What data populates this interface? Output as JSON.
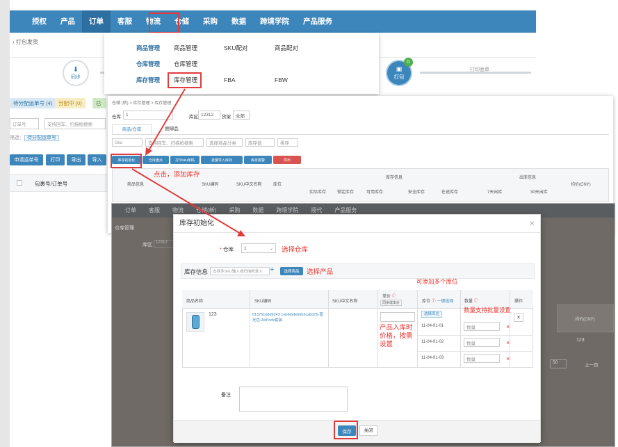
{
  "topnav": {
    "items": [
      "授权",
      "产品",
      "订单",
      "客服",
      "物流",
      "仓储",
      "采购",
      "数据",
      "跨境学院",
      "产品服务"
    ],
    "active": "仓储"
  },
  "breadcrumb": "打包发货",
  "mega_menu": {
    "rows": [
      {
        "head": "商品管理",
        "items": [
          "商品管理",
          "SKU配对",
          "商品配对"
        ]
      },
      {
        "head": "仓库管理",
        "items": [
          "仓库管理"
        ]
      },
      {
        "head": "库存管理",
        "items": [
          "库存管理",
          "FBA",
          "FBW"
        ]
      }
    ]
  },
  "steps": {
    "sync": "同步",
    "pack": "打包",
    "pack_badge": "0",
    "print": "打印面单"
  },
  "tags": {
    "distributed": "待分配运单号 (4)",
    "allocating": "分配中 (0)",
    "third": "已"
  },
  "left_filters": {
    "order_no": "订单号",
    "search_placeholder": "支持回车、扫描枪搜索",
    "chip": "待分配运单号"
  },
  "left_buttons": {
    "apply": "申请运单号",
    "print": "打印",
    "export": "导出",
    "import": "导入"
  },
  "left_table": {
    "col": "包裹号/订单号"
  },
  "inventory_panel": {
    "crumb": "仓储 (新) > 库存管理 > 库存管理",
    "warehouse_label": "仓库",
    "warehouse_value": "1",
    "area_label": "库区",
    "area_value": "12312",
    "filter_label": "货架",
    "filter_value": "全部",
    "tabs": [
      "商品/仓库",
      "捆绑品"
    ],
    "search_label": "Sku",
    "search_placeholder": "支持回车、扫描枪搜索",
    "category": "选择商品分类",
    "stock_status": "库存值",
    "sort": "排序",
    "buttons": [
      "库存初始化",
      "仓库盘点",
      "打印sku条码",
      "批量导入库存",
      "库存报警",
      "导出"
    ],
    "headers": [
      "商品信息",
      "SKU编码",
      "SKU中文名称",
      "库位",
      "实际库存",
      "锁定库存",
      "可用库存",
      "安全库存",
      "在途库存",
      "库存信息",
      "出库信息",
      "7天出库",
      "30天出库",
      "均价(CNY)"
    ]
  },
  "annotations": {
    "add_stock": "点击，添加库存",
    "select_warehouse": "选择仓库",
    "select_product": "选择产品",
    "multi_location": "可添加多个库位",
    "batch_qty": "数量支持批量设置",
    "price_note": "产品入库时价格，按需设置"
  },
  "modal": {
    "title": "库存初始化",
    "warehouse_label": "仓库",
    "warehouse_value": "1",
    "stock_info": "库存信息",
    "search_placeholder": "支持多SKU输入或扫描枪录入",
    "select_product_btn": "选择商品",
    "headers": [
      "商品名称",
      "SKU编码",
      "SKU中文名称",
      "单价",
      "库位",
      "数量",
      "操作"
    ],
    "price_sub": "同步成本价",
    "location_batch": "一键选择",
    "location_btn": "选择库位",
    "row": {
      "name": "123",
      "sku": "613751e8d9243 1eb6defeb0b3cabd7b-蓝光色-AirPods套装"
    },
    "locations": [
      "11-04-01-01",
      "11-04-01-02",
      "11-04-01-03"
    ],
    "qty_placeholder": "数量",
    "remark_label": "备注",
    "save": "保存",
    "close": "关闭"
  },
  "overlay_bg": {
    "nav": [
      "订单",
      "客服",
      "物流",
      "仓储(新)",
      "采购",
      "数据",
      "跨境学院",
      "授代",
      "产品服务"
    ],
    "crumb": "仓库管理",
    "area": "库区",
    "area_val": "12312",
    "price_col": "均价(CNY)",
    "price_val": "123",
    "pager": "上一页",
    "page_size": "50"
  },
  "colors": {
    "nav": "#3d86bb",
    "accent": "#3d86bb",
    "annotation": "#e8362f",
    "modal_save": "#3d86bb"
  }
}
